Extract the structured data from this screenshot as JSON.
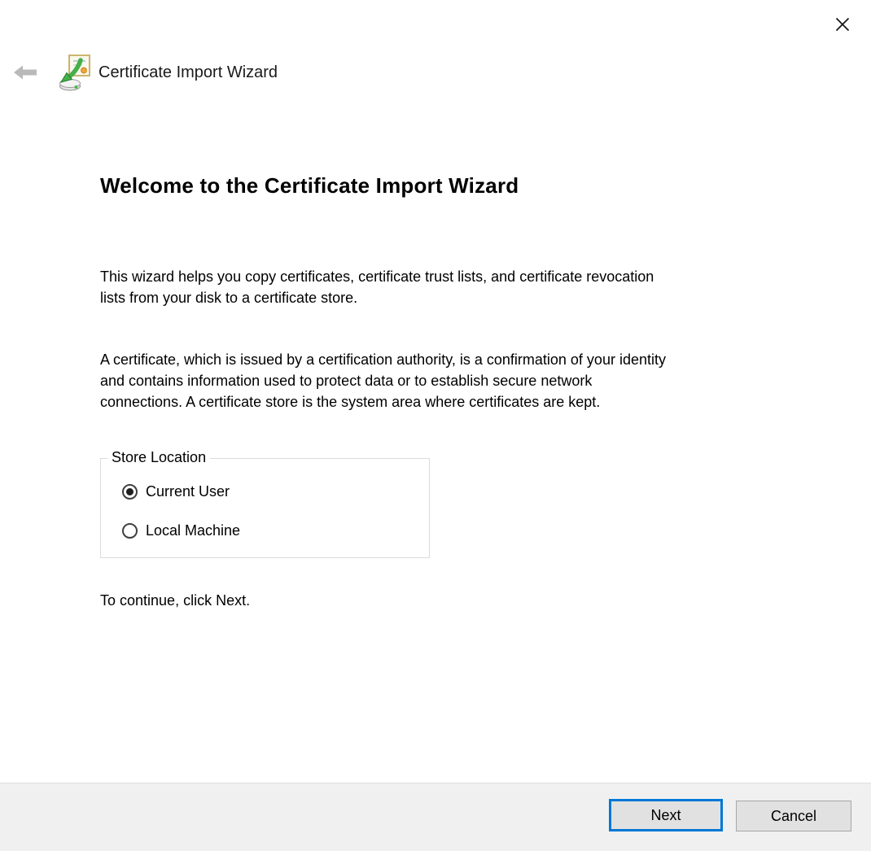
{
  "window": {
    "title": "Certificate Import Wizard"
  },
  "content": {
    "heading": "Welcome to the Certificate Import Wizard",
    "paragraph1": "This wizard helps you copy certificates, certificate trust lists, and certificate revocation\nlists from your disk to a certificate store.",
    "paragraph2": "A certificate, which is issued by a certification authority, is a confirmation of your identity\nand contains information used to protect data or to establish secure network\nconnections. A certificate store is the system area where certificates are kept.",
    "store_location": {
      "label": "Store Location",
      "options": [
        {
          "label": "Current User",
          "selected": true
        },
        {
          "label": "Local Machine",
          "selected": false
        }
      ]
    },
    "instruction": "To continue, click Next."
  },
  "footer": {
    "next_label": "Next",
    "cancel_label": "Cancel"
  },
  "icons": {
    "close": "close-icon",
    "back": "back-arrow-icon",
    "app": "certificate-import-icon",
    "radio_selected": "radio-selected-icon",
    "radio_unselected": "radio-unselected-icon"
  },
  "colors": {
    "accent": "#0078d7",
    "footer_bg": "#f0f0f0",
    "footer_border": "#dfdfdf",
    "button_bg": "#e1e1e1",
    "button_border": "#a6a6a6",
    "groupbox_border": "#dcdcdc",
    "disabled_icon": "#b9b9b9",
    "text": "#000000"
  }
}
